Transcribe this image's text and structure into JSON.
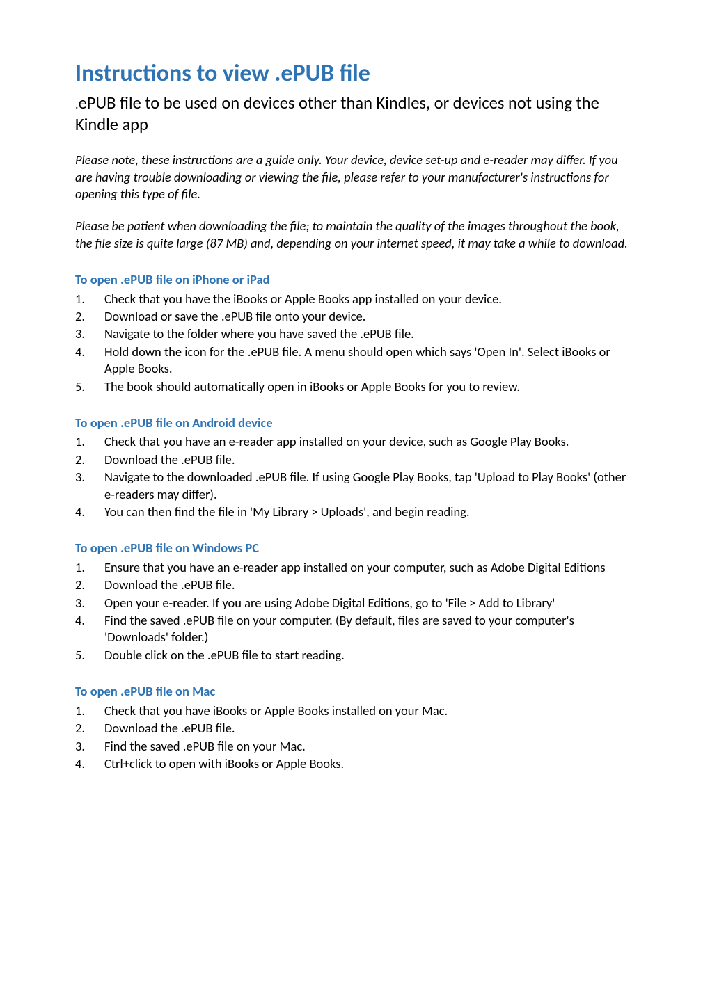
{
  "title": "Instructions to view .ePUB file",
  "subtitle_dot": ".",
  "subtitle_rest": "ePUB file to be used on devices other than Kindles, or devices not using the Kindle app",
  "note1": "Please note, these instructions are a guide only. Your device, device set-up and e-reader may differ. If you are having trouble downloading or viewing the file, please refer to your manufacturer's instructions for opening this type of file.",
  "note2": "Please be patient when downloading the file; to maintain the quality of the images throughout the book, the file size is quite large (87 MB) and, depending on your internet speed, it may take a while to download.",
  "sections": [
    {
      "heading": "To open .ePUB file on iPhone or iPad",
      "items": [
        "Check that you have the iBooks or Apple Books app installed on your device.",
        "Download or save the .ePUB file onto your device.",
        "Navigate to the folder where you have saved the .ePUB file.",
        "Hold down the icon for the .ePUB file. A menu should open which says 'Open In'. Select iBooks or Apple Books.",
        "The book should automatically open in iBooks or Apple Books for you to review."
      ]
    },
    {
      "heading": "To open .ePUB file on Android device",
      "items": [
        "Check that you have an e-reader app installed on your device, such as Google Play Books.",
        "Download the .ePUB file.",
        "Navigate to the downloaded .ePUB file. If using Google Play Books, tap 'Upload to Play Books' (other e-readers may differ).",
        "You can then find the file in 'My Library > Uploads', and begin reading."
      ]
    },
    {
      "heading": "To open .ePUB file on Windows PC",
      "items": [
        "Ensure that you have an e-reader app installed on your computer, such as Adobe Digital Editions",
        "Download the .ePUB file.",
        "Open your e-reader. If you are using Adobe Digital Editions, go to 'File > Add to Library'",
        "Find the saved .ePUB file on your computer. (By default, files are saved to your computer's 'Downloads' folder.)",
        "Double click on the .ePUB file to start reading."
      ]
    },
    {
      "heading": "To open .ePUB file on Mac",
      "items": [
        "Check that you have iBooks or Apple Books installed on your Mac.",
        "Download the .ePUB file.",
        "Find the saved .ePUB file on your Mac.",
        "Ctrl+click to open with iBooks or Apple Books."
      ]
    }
  ]
}
